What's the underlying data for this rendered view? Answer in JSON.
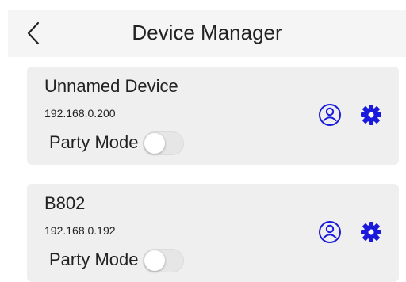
{
  "header": {
    "title": "Device Manager",
    "back_icon": "chevron-left-icon"
  },
  "devices": [
    {
      "name": "Unnamed Device",
      "ip": "192.168.0.200",
      "party_label": "Party Mode",
      "party_on": false,
      "user_icon": "user-circle-icon",
      "settings_icon": "gear-icon"
    },
    {
      "name": "B802",
      "ip": "192.168.0.192",
      "party_label": "Party Mode",
      "party_on": false,
      "user_icon": "user-circle-icon",
      "settings_icon": "gear-icon"
    }
  ],
  "colors": {
    "accent": "#1a1adc",
    "card_bg": "#efefef",
    "header_bg": "#f5f5f5"
  }
}
